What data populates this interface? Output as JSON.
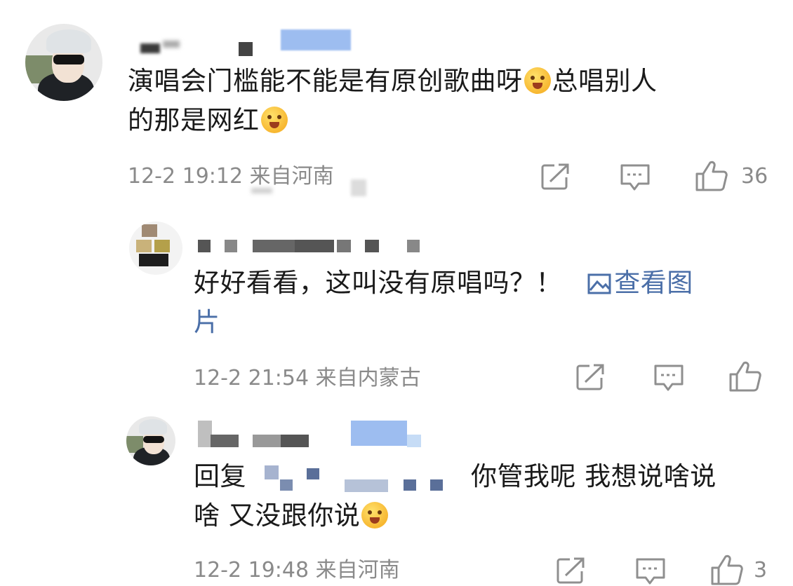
{
  "comments": [
    {
      "text_line1": "演唱会门槛能不能是有原创歌曲呀",
      "text_after_emoji": "总唱别人",
      "text_line2": "的那是网红",
      "meta": "12-2 19:12 来自河南",
      "likes": "36"
    },
    {
      "text": "好好看看，这叫没有原唱吗？！",
      "link_text_1": "查看图",
      "link_text_2": "片",
      "meta": "12-2 21:54 来自内蒙古",
      "likes": ""
    },
    {
      "reply_prefix": "回复",
      "text_line1": "你管我呢 我想说啥说",
      "text_line2": "啥 又没跟你说",
      "meta": "12-2 19:48 来自河南",
      "likes": "3"
    }
  ],
  "icons": {
    "share": "share-icon",
    "comment": "comment-icon",
    "like": "thumbs-up-icon",
    "picture": "image-icon",
    "emoji": "shy-face-emoji"
  },
  "colors": {
    "text": "#1a1a1a",
    "meta": "#8a8a8a",
    "link": "#4b6fa8",
    "icon": "#9a9a9a"
  }
}
